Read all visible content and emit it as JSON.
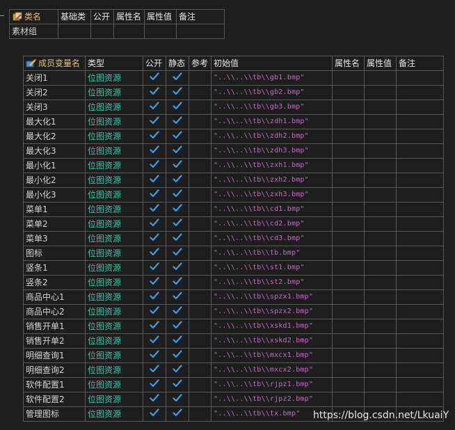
{
  "class_table": {
    "headers": [
      "类名",
      "基础类",
      "公开",
      "属性名",
      "属性值",
      "备注"
    ],
    "row": [
      "素材组",
      "",
      "",
      "",
      "",
      ""
    ]
  },
  "member_table": {
    "headers": [
      "成员变量名",
      "类型",
      "公开",
      "静态",
      "参考",
      "初始值",
      "属性名",
      "属性值",
      "备注"
    ],
    "rows": [
      {
        "name": "关闭1",
        "type": "位图资源",
        "public": true,
        "static": true,
        "value": "\"..\\\\..\\\\tb\\\\gb1.bmp\""
      },
      {
        "name": "关闭2",
        "type": "位图资源",
        "public": true,
        "static": true,
        "value": "\"..\\\\..\\\\tb\\\\gb2.bmp\""
      },
      {
        "name": "关闭3",
        "type": "位图资源",
        "public": true,
        "static": true,
        "value": "\"..\\\\..\\\\tb\\\\gb3.bmp\""
      },
      {
        "name": "最大化1",
        "type": "位图资源",
        "public": true,
        "static": true,
        "value": "\"..\\\\..\\\\tb\\\\zdh1.bmp\""
      },
      {
        "name": "最大化2",
        "type": "位图资源",
        "public": true,
        "static": true,
        "value": "\"..\\\\..\\\\tb\\\\zdh2.bmp\""
      },
      {
        "name": "最大化3",
        "type": "位图资源",
        "public": true,
        "static": true,
        "value": "\"..\\\\..\\\\tb\\\\zdh3.bmp\""
      },
      {
        "name": "最小化1",
        "type": "位图资源",
        "public": true,
        "static": true,
        "value": "\"..\\\\..\\\\tb\\\\zxh1.bmp\""
      },
      {
        "name": "最小化2",
        "type": "位图资源",
        "public": true,
        "static": true,
        "value": "\"..\\\\..\\\\tb\\\\zxh2.bmp\""
      },
      {
        "name": "最小化3",
        "type": "位图资源",
        "public": true,
        "static": true,
        "value": "\"..\\\\..\\\\tb\\\\zxh3.bmp\""
      },
      {
        "name": "菜单1",
        "type": "位图资源",
        "public": true,
        "static": true,
        "value": "\"..\\\\..\\\\tb\\\\cd1.bmp\""
      },
      {
        "name": "菜单2",
        "type": "位图资源",
        "public": true,
        "static": true,
        "value": "\"..\\\\..\\\\tb\\\\cd2.bmp\""
      },
      {
        "name": "菜单3",
        "type": "位图资源",
        "public": true,
        "static": true,
        "value": "\"..\\\\..\\\\tb\\\\cd3.bmp\""
      },
      {
        "name": "图标",
        "type": "位图资源",
        "public": true,
        "static": true,
        "value": "\"..\\\\..\\\\tb\\\\tb.bmp\""
      },
      {
        "name": "竖条1",
        "type": "位图资源",
        "public": true,
        "static": true,
        "value": "\"..\\\\..\\\\tb\\\\st1.bmp\""
      },
      {
        "name": "竖条2",
        "type": "位图资源",
        "public": true,
        "static": true,
        "value": "\"..\\\\..\\\\tb\\\\st2.bmp\""
      },
      {
        "name": "商品中心1",
        "type": "位图资源",
        "public": true,
        "static": true,
        "value": "\"..\\\\..\\\\tb\\\\spzx1.bmp\""
      },
      {
        "name": "商品中心2",
        "type": "位图资源",
        "public": true,
        "static": true,
        "value": "\"..\\\\..\\\\tb\\\\spzx2.bmp\""
      },
      {
        "name": "销售开单1",
        "type": "位图资源",
        "public": true,
        "static": true,
        "value": "\"..\\\\..\\\\tb\\\\xskd1.bmp\""
      },
      {
        "name": "销售开单2",
        "type": "位图资源",
        "public": true,
        "static": true,
        "value": "\"..\\\\..\\\\tb\\\\xskd2.bmp\""
      },
      {
        "name": "明细查询1",
        "type": "位图资源",
        "public": true,
        "static": true,
        "value": "\"..\\\\..\\\\tb\\\\mxcx1.bmp\""
      },
      {
        "name": "明细查询2",
        "type": "位图资源",
        "public": true,
        "static": true,
        "value": "\"..\\\\..\\\\tb\\\\mxcx2.bmp\""
      },
      {
        "name": "软件配置1",
        "type": "位图资源",
        "public": true,
        "static": true,
        "value": "\"..\\\\..\\\\tb\\\\rjpz1.bmp\""
      },
      {
        "name": "软件配置2",
        "type": "位图资源",
        "public": true,
        "static": true,
        "value": "\"..\\\\..\\\\tb\\\\rjpz2.bmp\""
      },
      {
        "name": "管理图标",
        "type": "位图资源",
        "public": true,
        "static": true,
        "value": "\"..\\\\..\\\\tb\\\\tx.bmp\""
      }
    ]
  },
  "watermark": "https://blog.csdn.net/LkuaiY",
  "colors": {
    "name": "#d4d4d4",
    "type": "#40c0a8",
    "value": "#c66ac8",
    "check": "#3f9fe6",
    "grid": "#5a5a5a"
  }
}
